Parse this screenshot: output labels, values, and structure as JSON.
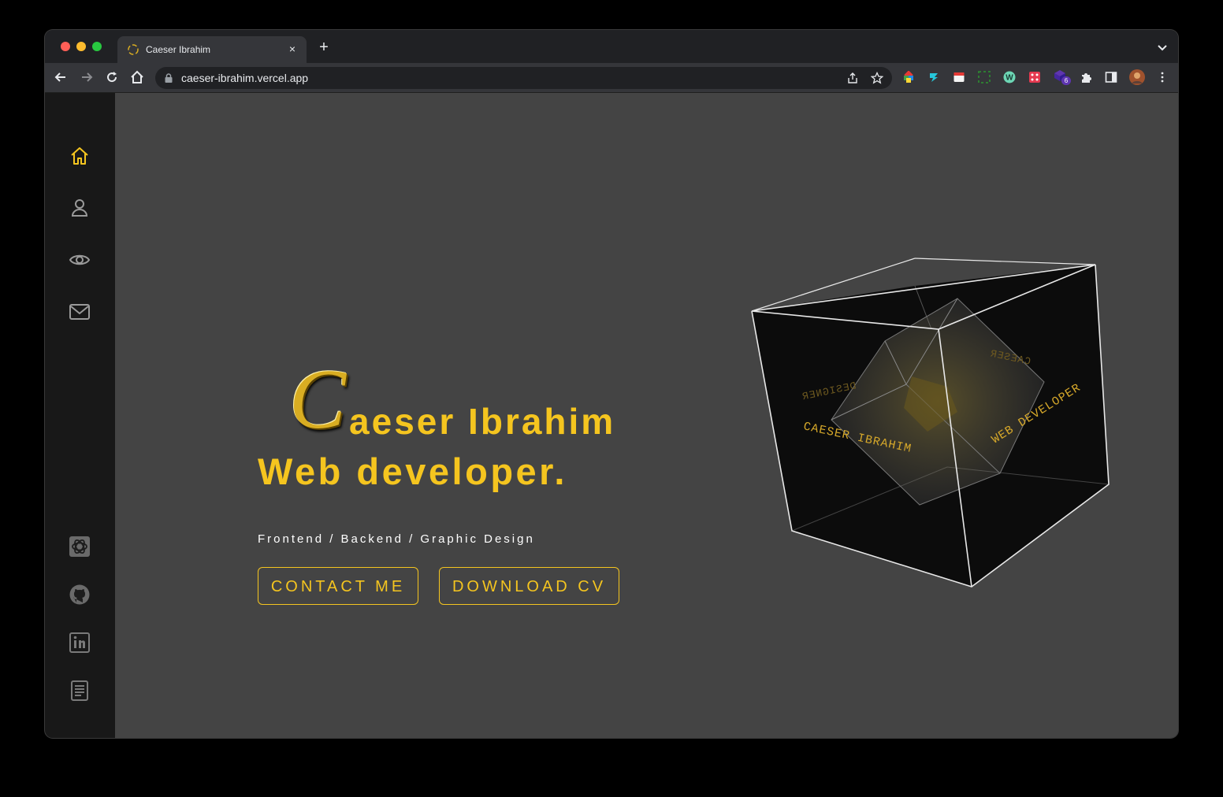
{
  "browser": {
    "tab_title": "Caeser Ibrahim",
    "tab_close": "×",
    "new_tab": "+",
    "url": "caeser-ibrahim.vercel.app",
    "extension_badge": "6"
  },
  "hero": {
    "initial": "C",
    "name_rest": "aeser Ibrahim",
    "subtitle": "Web developer.",
    "skills": "Frontend / Backend / Graphic Design",
    "buttons": {
      "contact": "CONTACT ME",
      "download": "DOWNLOAD CV"
    }
  },
  "cube": {
    "front_text": "CAESER IBRAHIM",
    "right_text": "WEB DEVELOPER",
    "back_left_text": "DESIGNER",
    "back_right_text": "CAESER"
  },
  "sidebar": {
    "items": [
      {
        "icon": "home-icon",
        "active": true
      },
      {
        "icon": "user-icon",
        "active": false
      },
      {
        "icon": "eye-icon",
        "active": false
      },
      {
        "icon": "mail-icon",
        "active": false
      }
    ],
    "social": [
      "chatgpt-icon",
      "github-icon",
      "linkedin-icon",
      "resume-icon"
    ]
  },
  "colors": {
    "accent": "#f5c51f",
    "page_bg": "#444444",
    "sidebar_bg": "#181818"
  }
}
